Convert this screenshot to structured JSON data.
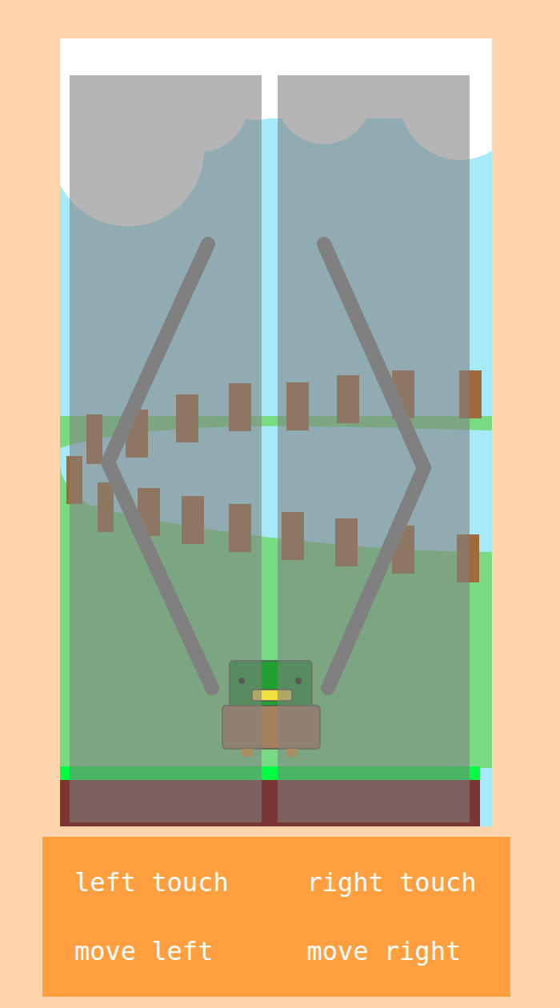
{
  "controls": [
    {
      "action": "left touch",
      "result": "move left"
    },
    {
      "action": "right touch",
      "result": "move right"
    }
  ]
}
